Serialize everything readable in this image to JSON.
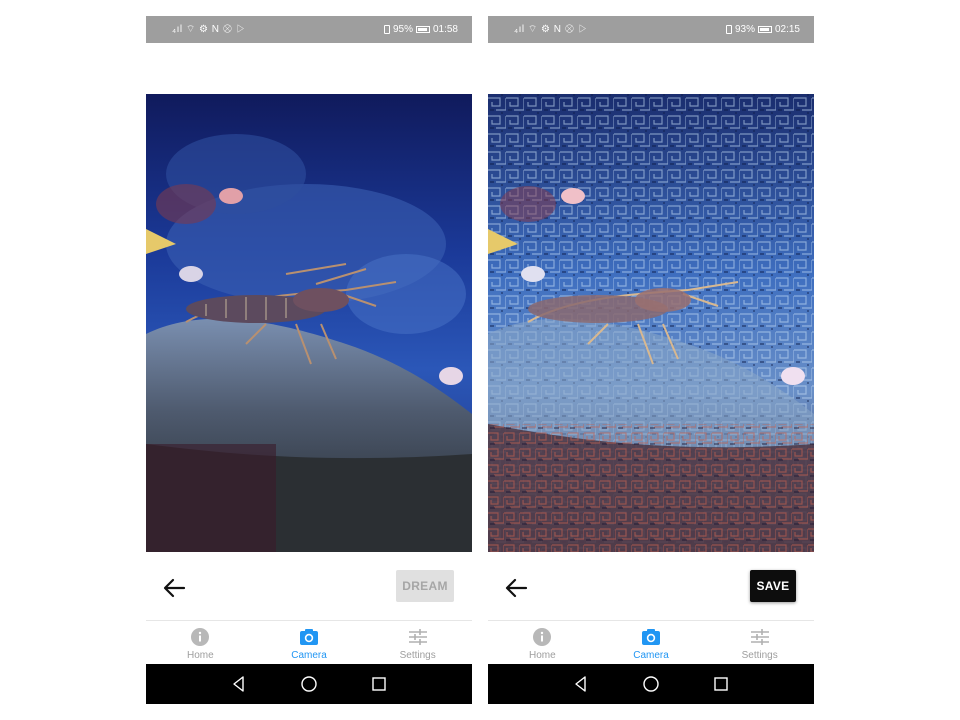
{
  "colors": {
    "status_bar": "#9e9e9e",
    "accent": "#2196f3",
    "inactive": "#9e9e9e",
    "dream_disabled_bg": "#e0e0e0",
    "save_bg": "#0d0d0d",
    "system_nav": "#000000"
  },
  "screens": [
    {
      "status": {
        "icons": "₄ıl ⌔ ⚙ N ⊗ ▷",
        "battery": "95%",
        "time": "01:58"
      },
      "photo": {
        "description_icon": "lobster-photo"
      },
      "action": {
        "label": "DREAM",
        "enabled": false
      },
      "nav": {
        "items": [
          {
            "label": "Home",
            "icon": "info-icon",
            "active": false
          },
          {
            "label": "Camera",
            "icon": "camera-icon",
            "active": true
          },
          {
            "label": "Settings",
            "icon": "sliders-icon",
            "active": false
          }
        ]
      }
    },
    {
      "status": {
        "icons": "₄ıl ⌔ ⚙ N ⊗ ▷",
        "battery": "93%",
        "time": "02:15"
      },
      "photo": {
        "description_icon": "deepdream-photo"
      },
      "action": {
        "label": "SAVE",
        "enabled": true
      },
      "nav": {
        "items": [
          {
            "label": "Home",
            "icon": "info-icon",
            "active": false
          },
          {
            "label": "Camera",
            "icon": "camera-icon",
            "active": true
          },
          {
            "label": "Settings",
            "icon": "sliders-icon",
            "active": false
          }
        ]
      }
    }
  ]
}
